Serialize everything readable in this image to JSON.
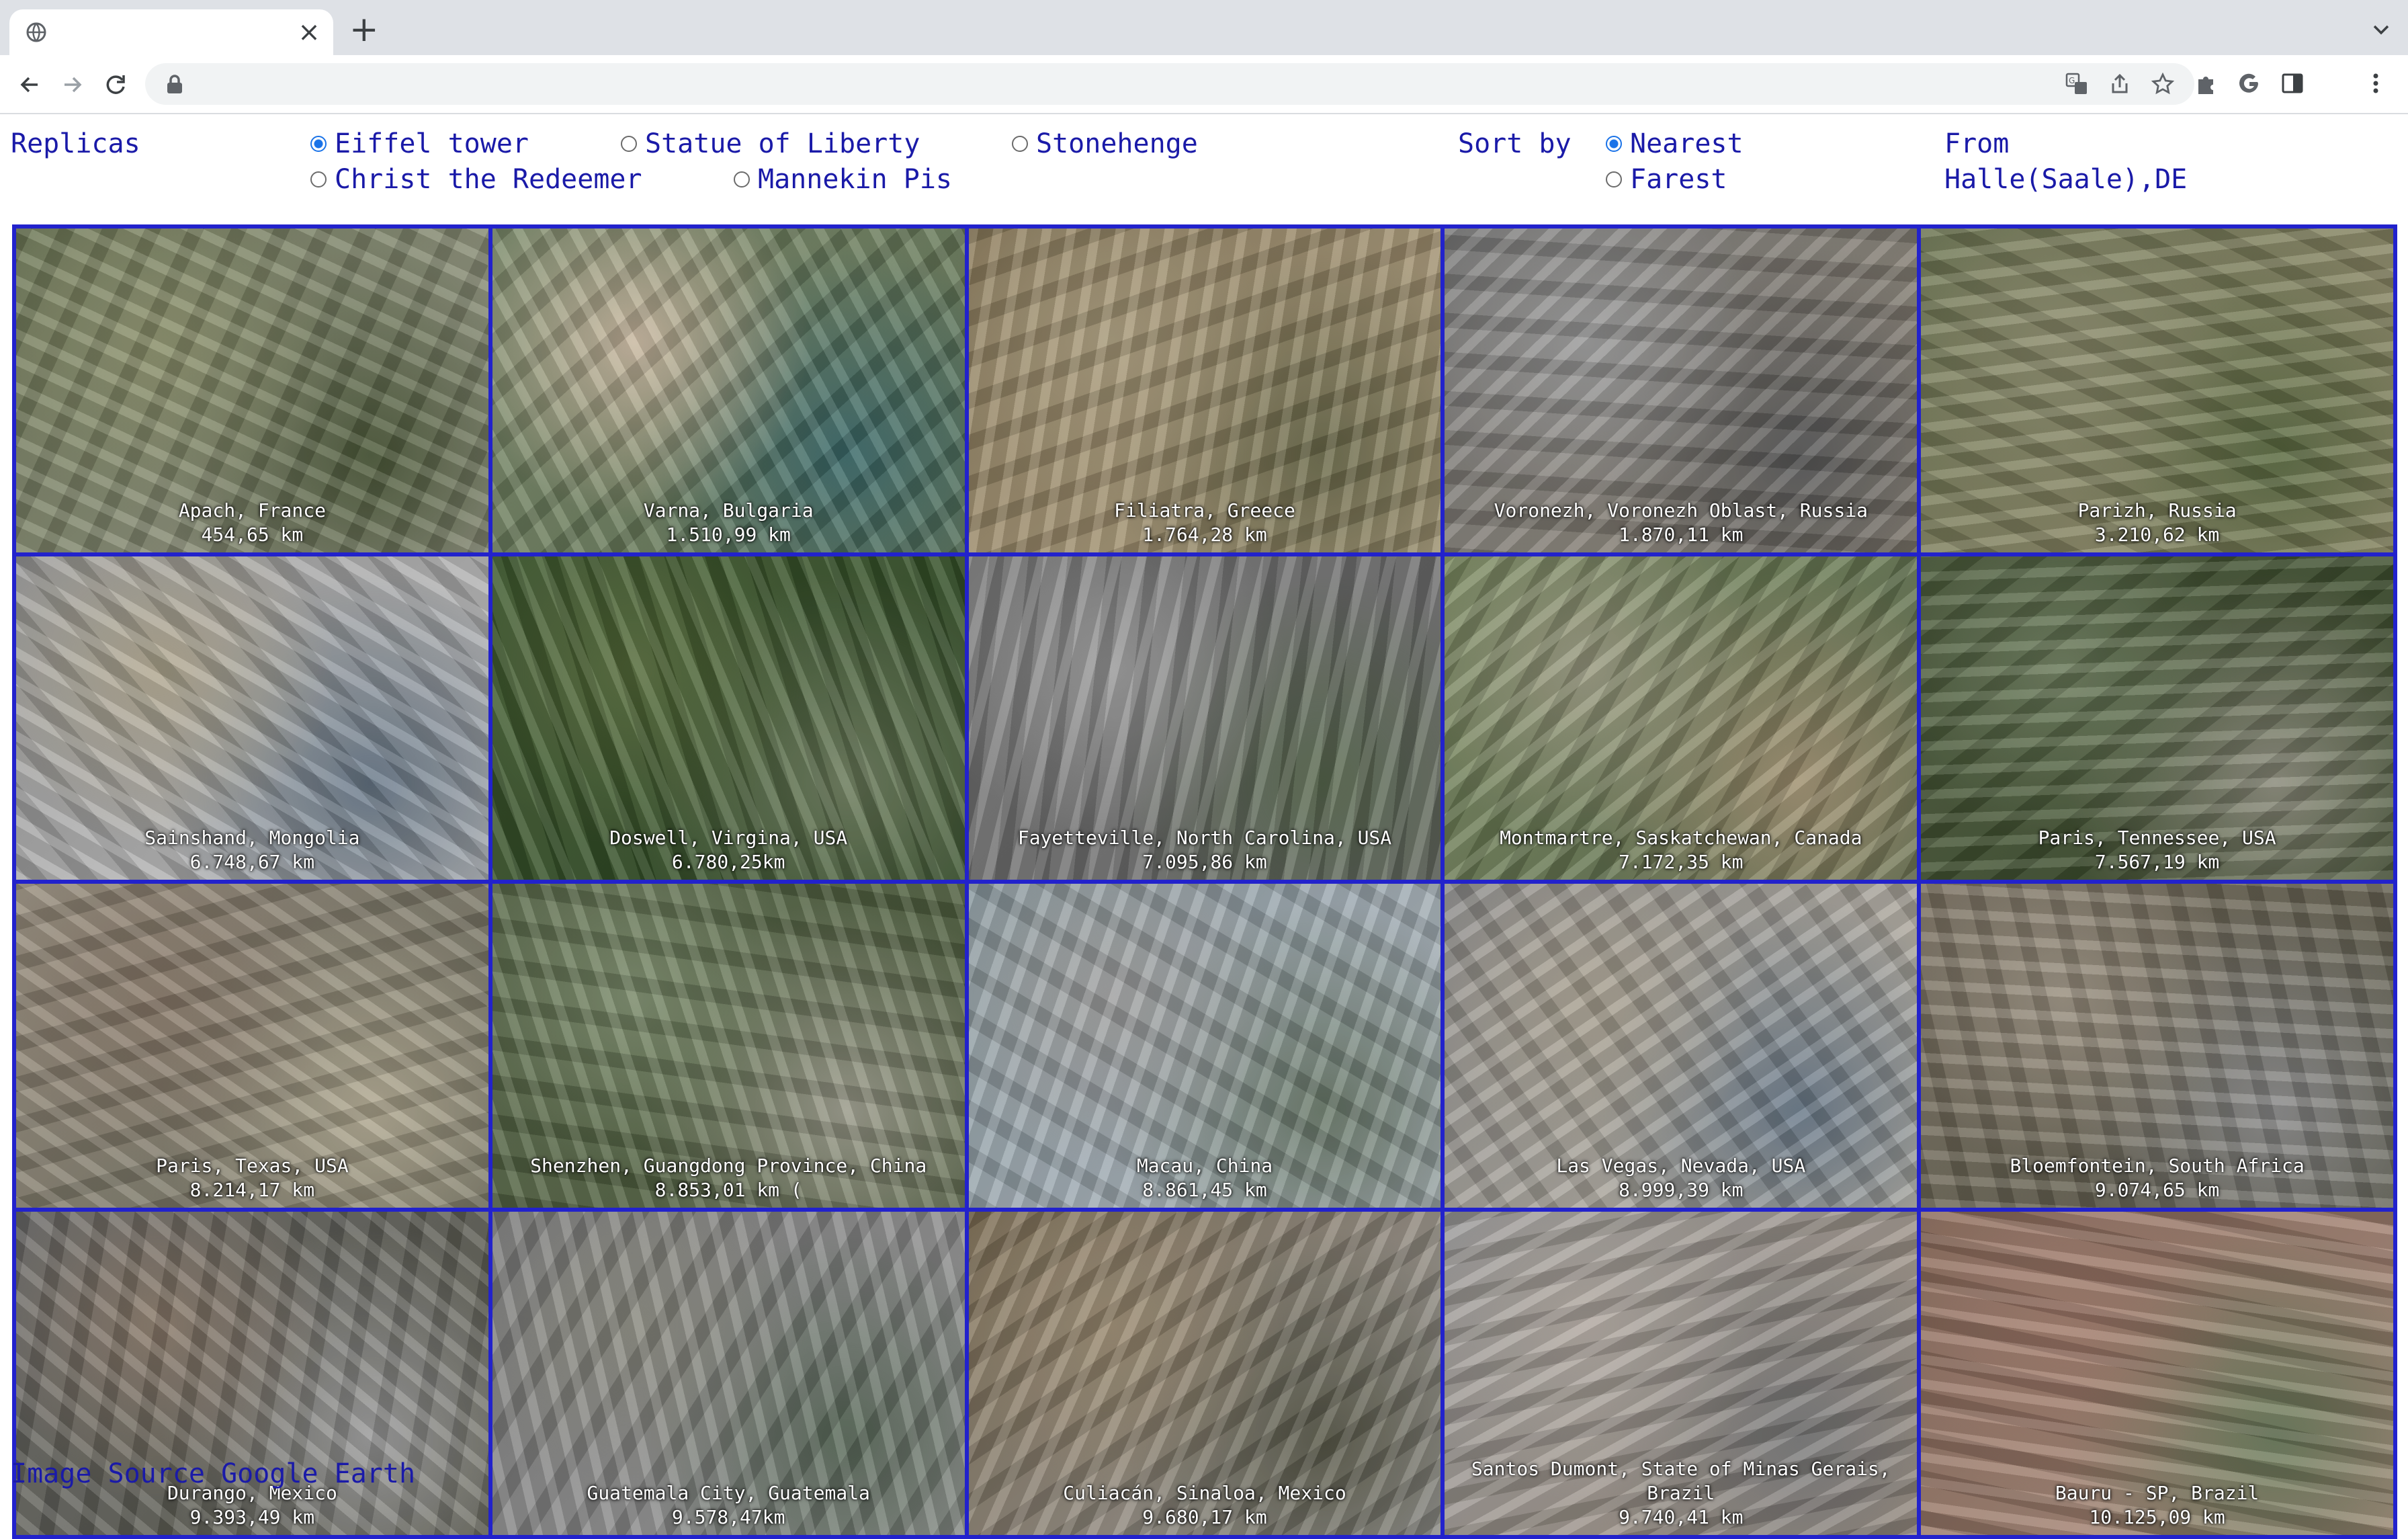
{
  "browser": {
    "tab": {
      "title": "",
      "close_glyph": "×"
    },
    "new_tab_glyph": "+",
    "address": ""
  },
  "controls": {
    "replicas_label": "Replicas",
    "options": [
      {
        "label": "Eiffel tower",
        "checked": true
      },
      {
        "label": "Statue of Liberty",
        "checked": false
      },
      {
        "label": "Stonehenge",
        "checked": false
      },
      {
        "label": "Christ the Redeemer",
        "checked": false
      },
      {
        "label": "Mannekin Pis",
        "checked": false
      }
    ],
    "sort_label": "Sort by",
    "sort_options": [
      {
        "label": "Nearest",
        "checked": true
      },
      {
        "label": "Farest",
        "checked": false
      }
    ],
    "from_label": "From",
    "from_value": "Halle(Saale),DE"
  },
  "tiles": [
    {
      "place": "Apach, France",
      "distance": "454,65 km",
      "colors": [
        "#6b7654",
        "#8a8f6a",
        "#4d5a3a",
        "#9a9a8a"
      ]
    },
    {
      "place": "Varna, Bulgaria",
      "distance": "1.510,99 km",
      "colors": [
        "#7a8a6a",
        "#c9b8a0",
        "#3b6a6a",
        "#5d7050"
      ]
    },
    {
      "place": "Filiatra, Greece",
      "distance": "1.764,28 km",
      "colors": [
        "#8a7a5a",
        "#a89a7a",
        "#6b6a4a",
        "#b0a080"
      ]
    },
    {
      "place": "Voronezh, Voronezh Oblast, Russia",
      "distance": "1.870,11 km",
      "colors": [
        "#7a7a7a",
        "#9a9a9a",
        "#5a5a5a",
        "#8a8070"
      ]
    },
    {
      "place": "Parizh, Russia",
      "distance": "3.210,62 km",
      "colors": [
        "#6a7450",
        "#8a8a6a",
        "#5a6a40",
        "#9a9070"
      ]
    },
    {
      "place": "Sainshand, Mongolia",
      "distance": "6.748,67 km",
      "colors": [
        "#9a9a9a",
        "#b0a890",
        "#6a7a8a",
        "#c0c0c0"
      ]
    },
    {
      "place": "Doswell, Virgina, USA",
      "distance": "6.780,25km",
      "colors": [
        "#3f5a2f",
        "#556b3a",
        "#6a7a5a",
        "#2f4a25"
      ]
    },
    {
      "place": "Fayetteville, North Carolina, USA",
      "distance": "7.095,86 km",
      "colors": [
        "#7a7a7a",
        "#9a9a9a",
        "#5a6a50",
        "#6a6a6a"
      ]
    },
    {
      "place": "Montmartre, Saskatchewan, Canada",
      "distance": "7.172,35 km",
      "colors": [
        "#7a8a60",
        "#9a9a80",
        "#a09070",
        "#5a6a4a"
      ]
    },
    {
      "place": "Paris, Tennessee, USA",
      "distance": "7.567,19 km",
      "colors": [
        "#4a5a3a",
        "#6a7a5a",
        "#8a8a7a",
        "#3a4a2a"
      ]
    },
    {
      "place": "Paris, Texas, USA",
      "distance": "8.214,17 km",
      "colors": [
        "#9a9080",
        "#8a7a6a",
        "#b0a890",
        "#6a6a5a"
      ]
    },
    {
      "place": "Shenzhen, Guangdong Province, China",
      "distance": "8.853,01 km (",
      "colors": [
        "#5a6a4a",
        "#7a8a6a",
        "#9a9a8a",
        "#4a5a3a"
      ]
    },
    {
      "place": "Macau, China",
      "distance": "8.861,45 km",
      "colors": [
        "#8a9aa0",
        "#a0a0a0",
        "#6a7a6a",
        "#b0b8c0"
      ]
    },
    {
      "place": "Las Vegas, Nevada, USA",
      "distance": "8.999,39 km",
      "colors": [
        "#8a8a8a",
        "#a8a090",
        "#6a7a8a",
        "#c0b8a8"
      ]
    },
    {
      "place": "Bloemfontein, South Africa",
      "distance": "9.074,65 km",
      "colors": [
        "#7a7060",
        "#9a9080",
        "#8a8a8a",
        "#5a5a4a"
      ]
    },
    {
      "place": "Durango, Mexico",
      "distance": "9.393,49 km",
      "colors": [
        "#6a6a6a",
        "#8a7a6a",
        "#9a9a9a",
        "#5a5a4a"
      ]
    },
    {
      "place": "Guatemala City, Guatemala",
      "distance": "9.578,47km",
      "colors": [
        "#7a7a7a",
        "#8a8a80",
        "#5a6a5a",
        "#9a9a9a"
      ]
    },
    {
      "place": "Culiacán, Sinaloa, Mexico",
      "distance": "9.680,17 km",
      "colors": [
        "#7a6a50",
        "#9a8a70",
        "#5a5a4a",
        "#a0a0a0"
      ]
    },
    {
      "place": "Santos Dumont, State of Minas Gerais, Brazil",
      "distance": "9.740,41 km",
      "colors": [
        "#9a9a9a",
        "#b0a8a0",
        "#7a7a7a",
        "#a09080"
      ]
    },
    {
      "place": "Bauru - SP, Brazil",
      "distance": "10.125,09 km",
      "colors": [
        "#8a6a5a",
        "#a07a6a",
        "#6a7a5a",
        "#b09080"
      ]
    }
  ],
  "footer": "Image Source Google Earth"
}
